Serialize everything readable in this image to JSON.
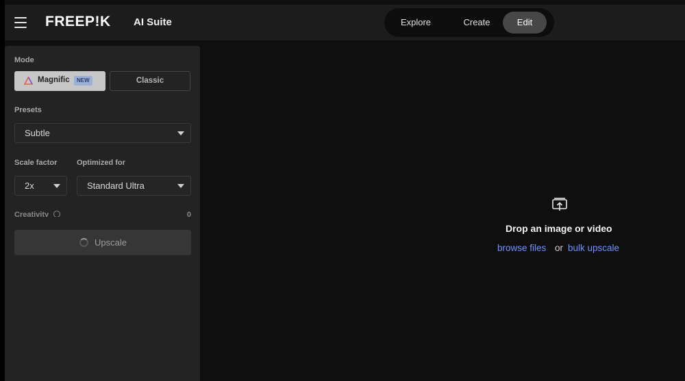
{
  "header": {
    "logo": "FREEP!K",
    "suite": "AI Suite",
    "nav": {
      "explore": "Explore",
      "create": "Create",
      "edit": "Edit"
    },
    "active_nav": "Edit"
  },
  "panel": {
    "mode_label": "Mode",
    "mode_magnific": "Magnific",
    "mode_magnific_badge": "NEW",
    "mode_classic": "Classic",
    "presets_label": "Presets",
    "presets_value": "Subtle",
    "scale_label": "Scale factor",
    "scale_value": "2x",
    "optimized_label": "Optimized for",
    "optimized_value": "Standard Ultra",
    "creativity_label": "Creativity",
    "creativity_value": "0",
    "upscale_label": "Upscale"
  },
  "drop": {
    "title": "Drop an image or video",
    "browse": "browse files",
    "or": "or",
    "bulk": "bulk upscale"
  },
  "colors": {
    "accent_link": "#6f93ff",
    "badge_bg": "#9bb0d6"
  }
}
